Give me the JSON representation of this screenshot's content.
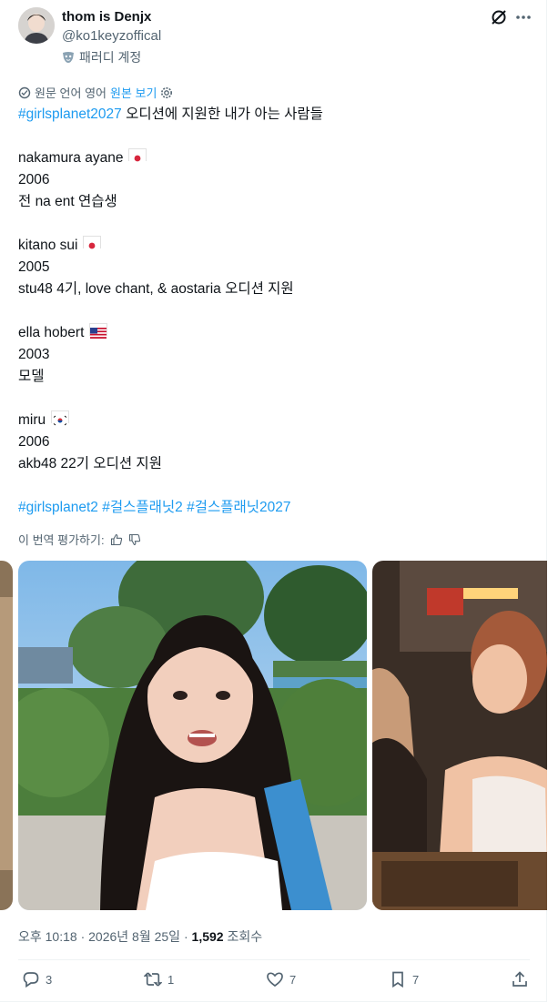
{
  "author": {
    "display_name": "thom is Denjx",
    "handle": "@ko1keyzoffical",
    "parody_label": "패러디 계정",
    "avatar_icon": "person-avatar"
  },
  "translation": {
    "source_text": "원문 언어 영어",
    "show_original": "원본 보기"
  },
  "post": {
    "line_1_hashtag": "#girlsplanet2027",
    "line_1_text": " 오디션에 지원한 내가 아는 사람들",
    "people": [
      {
        "name": "nakamura ayane",
        "flag": "JP",
        "year": "2006",
        "note": "전 na ent 연습생"
      },
      {
        "name": "kitano sui",
        "flag": "JP",
        "year": "2005",
        "note": "stu48 4기, love chant, & aostaria 오디션 지원"
      },
      {
        "name": "ella hobert",
        "flag": "US",
        "year": "2003",
        "note": "모델"
      },
      {
        "name": "miru",
        "flag": "KR",
        "year": "2006",
        "note": "akb48 22기 오디션 지원"
      }
    ],
    "hashtags": [
      "#girlsplanet2",
      "#걸스플래닛2",
      "#걸스플래닛2027"
    ]
  },
  "rate_translation": "이 번역 평가하기:",
  "meta": {
    "time": "오후 10:18",
    "date": "2026년 8월 25일",
    "views_count": "1,592",
    "views_label": "조회수"
  },
  "actions": {
    "replies": "3",
    "reposts": "1",
    "likes": "7",
    "bookmarks": "7"
  },
  "colors": {
    "accent": "#1d9bf0",
    "secondary_text": "#536471",
    "primary_text": "#0f1419"
  }
}
